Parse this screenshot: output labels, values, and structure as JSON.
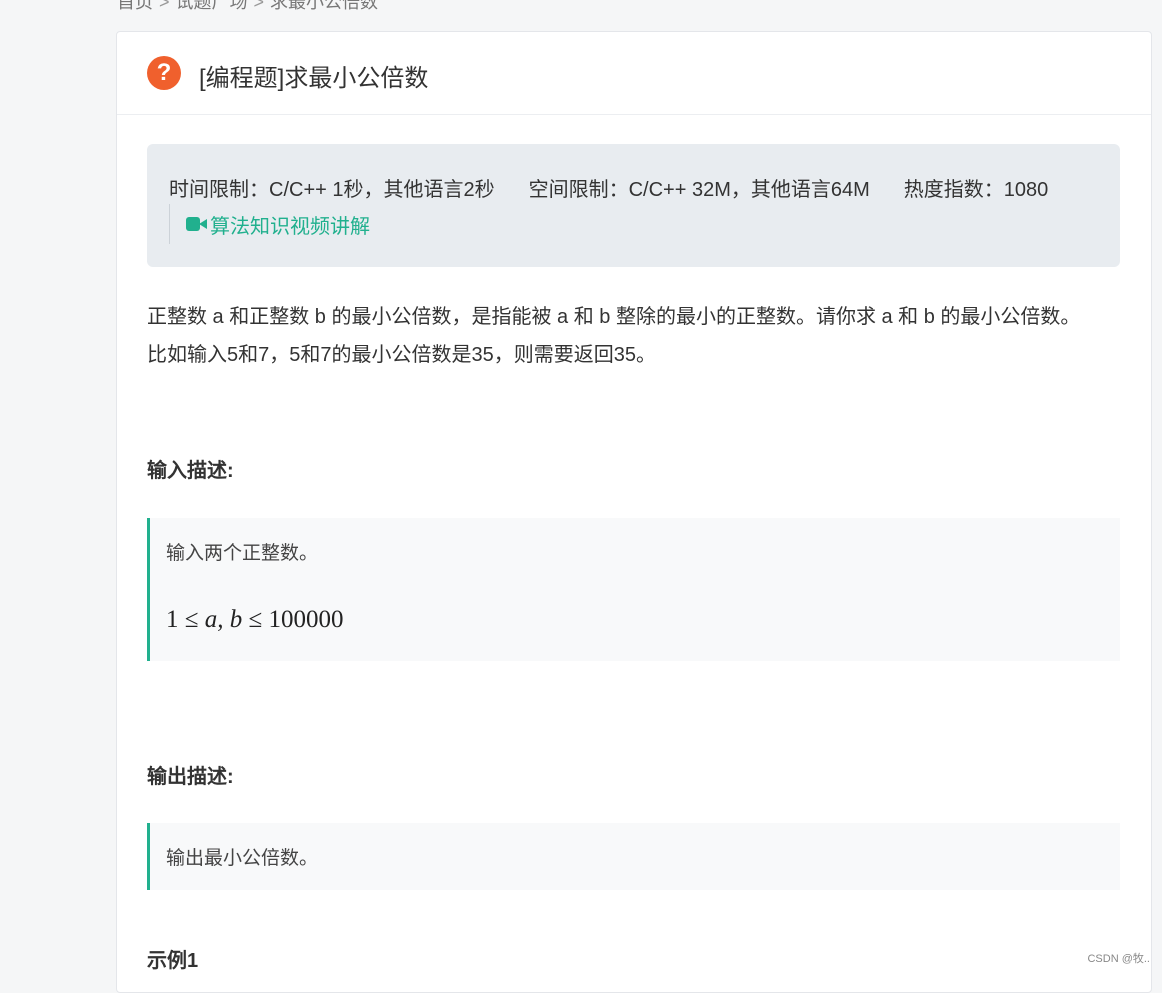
{
  "breadcrumb": {
    "items": [
      "首页",
      "试题广场",
      "求最小公倍数"
    ],
    "separator": ">"
  },
  "question": {
    "icon": "question-circle-icon",
    "title": "[编程题]求最小公倍数"
  },
  "limits": {
    "time": "时间限制：C/C++ 1秒，其他语言2秒",
    "space": "空间限制：C/C++ 32M，其他语言64M",
    "heat": "热度指数：1080",
    "video_link": "算法知识视频讲解",
    "video_icon": "video-camera-icon"
  },
  "description": {
    "line1": "正整数 a 和正整数 b 的最小公倍数，是指能被 a 和 b 整除的最小的正整数。请你求 a 和 b 的最小公倍数。",
    "line2": "比如输入5和7，5和7的最小公倍数是35，则需要返回35。"
  },
  "input_section": {
    "title": "输入描述:",
    "text": "输入两个正整数。",
    "constraint": {
      "lhs": "1",
      "le": "≤",
      "vars": "a, b",
      "rhs": "100000"
    }
  },
  "output_section": {
    "title": "输出描述:",
    "text": "输出最小公倍数。"
  },
  "example": {
    "title": "示例1"
  },
  "watermark": "CSDN @牧.."
}
